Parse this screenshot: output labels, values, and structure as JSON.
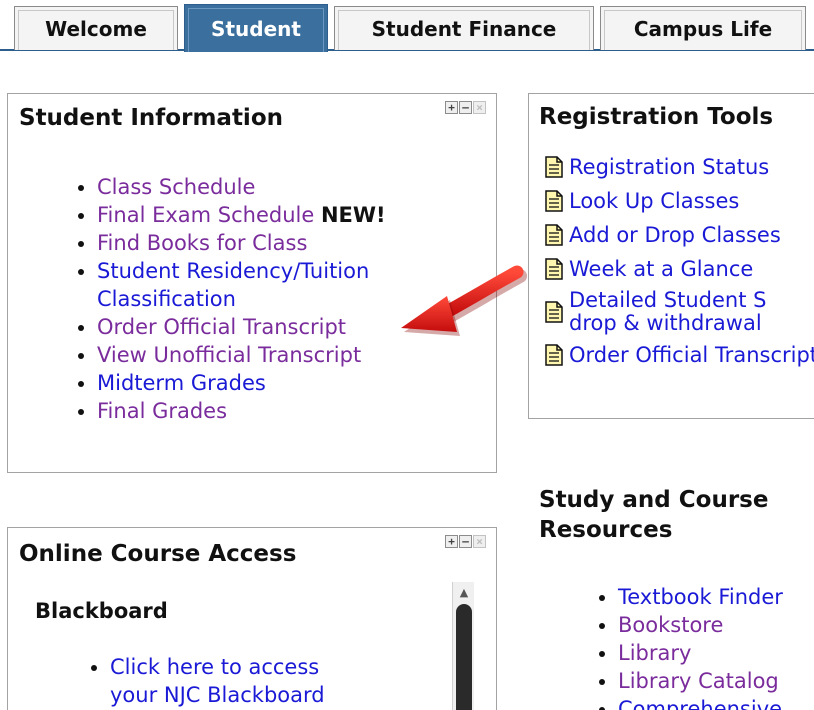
{
  "tabs": [
    {
      "label": "Welcome",
      "active": false
    },
    {
      "label": "Student",
      "active": true
    },
    {
      "label": "Student Finance",
      "active": false
    },
    {
      "label": "Campus Life",
      "active": false
    }
  ],
  "student_info": {
    "title": "Student Information",
    "controls": {
      "add": "+",
      "minimize": "–",
      "close": "×"
    },
    "links": [
      {
        "label": "Class Schedule"
      },
      {
        "label": "Final Exam Schedule",
        "badge": "NEW!"
      },
      {
        "label": "Find Books for Class"
      },
      {
        "label": "Student Residency/Tuition Classification"
      },
      {
        "label": "Order Official Transcript"
      },
      {
        "label": "View Unofficial Transcript"
      },
      {
        "label": "Midterm Grades"
      },
      {
        "label": "Final Grades"
      }
    ]
  },
  "registration_tools": {
    "title": "Registration Tools",
    "items": [
      {
        "label": "Registration Status"
      },
      {
        "label": "Look Up Classes"
      },
      {
        "label": "Add or Drop Classes"
      },
      {
        "label": "Week at a Glance"
      },
      {
        "label_line1": "Detailed Student S",
        "label_line2": "drop & withdrawal"
      },
      {
        "label": "Order Official Transcript"
      }
    ]
  },
  "online_course": {
    "title": "Online Course Access",
    "controls": {
      "add": "+",
      "minimize": "–",
      "close": "×"
    },
    "subheading": "Blackboard",
    "links": [
      {
        "label_line1": "Click here to access",
        "label_line2": "your NJC Blackboard"
      }
    ],
    "scroll_up": "▲"
  },
  "study_resources": {
    "title_line1": "Study and Course",
    "title_line2": "Resources",
    "links": [
      {
        "label": "Textbook Finder"
      },
      {
        "label": "Bookstore"
      },
      {
        "label": "Library"
      },
      {
        "label": "Library Catalog"
      },
      {
        "label": "Comprehensive"
      }
    ]
  },
  "colors": {
    "active_tab": "#3a6f9e",
    "link": "#1a1ad6",
    "visited_link": "#7a2c9c",
    "arrow": "#e31b1b"
  }
}
